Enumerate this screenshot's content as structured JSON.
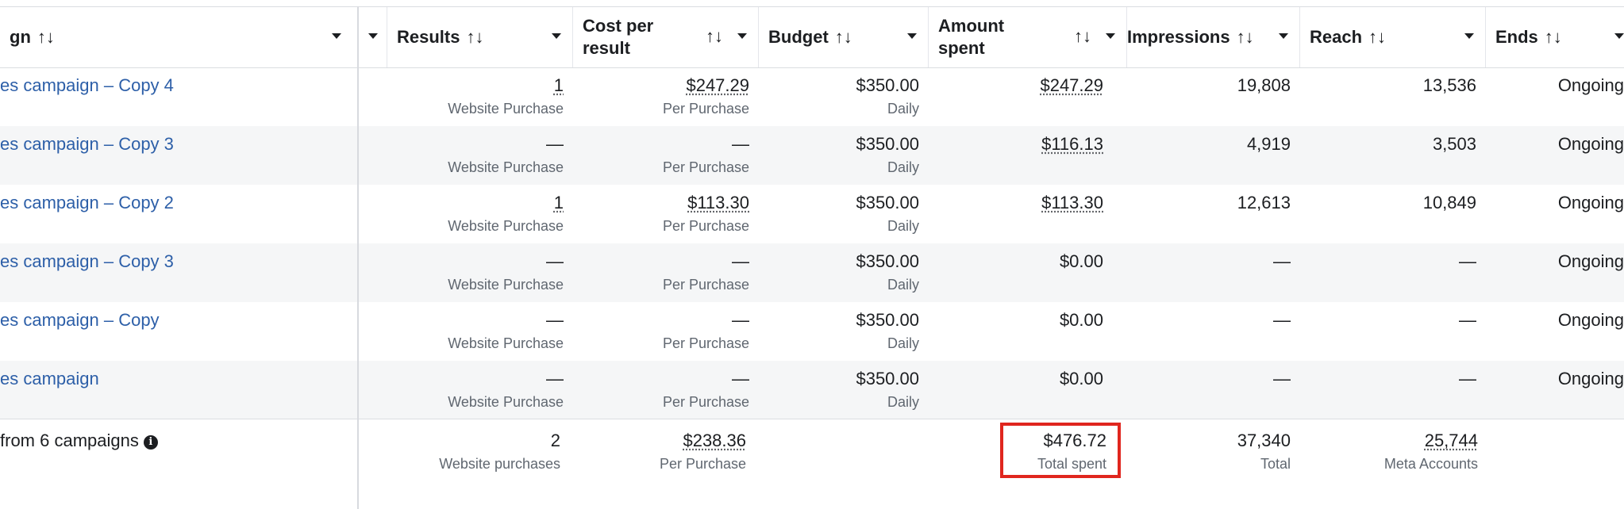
{
  "header": {
    "campaign": "gn",
    "results": "Results",
    "cost_per_result_line1": "Cost per",
    "cost_per_result_line2": "result",
    "budget": "Budget",
    "amount_spent_line1": "Amount",
    "amount_spent_line2": "spent",
    "impressions": "Impressions",
    "reach": "Reach",
    "ends": "Ends",
    "sort_glyph": "↑↓"
  },
  "rows": [
    {
      "name": "es campaign – Copy 4",
      "results": "1",
      "results_sub": "Website Purchase",
      "cost": "$247.29",
      "cost_sub": "Per Purchase",
      "budget": "$350.00",
      "budget_sub": "Daily",
      "spent": "$247.29",
      "impressions": "19,808",
      "reach": "13,536",
      "ends": "Ongoing"
    },
    {
      "name": "es campaign – Copy 3",
      "results": "—",
      "results_sub": "Website Purchase",
      "cost": "—",
      "cost_sub": "Per Purchase",
      "budget": "$350.00",
      "budget_sub": "Daily",
      "spent": "$116.13",
      "impressions": "4,919",
      "reach": "3,503",
      "ends": "Ongoing"
    },
    {
      "name": "es campaign – Copy 2",
      "results": "1",
      "results_sub": "Website Purchase",
      "cost": "$113.30",
      "cost_sub": "Per Purchase",
      "budget": "$350.00",
      "budget_sub": "Daily",
      "spent": "$113.30",
      "impressions": "12,613",
      "reach": "10,849",
      "ends": "Ongoing"
    },
    {
      "name": "es campaign – Copy 3",
      "results": "—",
      "results_sub": "Website Purchase",
      "cost": "—",
      "cost_sub": "Per Purchase",
      "budget": "$350.00",
      "budget_sub": "Daily",
      "spent": "$0.00",
      "impressions": "—",
      "reach": "—",
      "ends": "Ongoing"
    },
    {
      "name": "es campaign – Copy",
      "results": "—",
      "results_sub": "Website Purchase",
      "cost": "—",
      "cost_sub": "Per Purchase",
      "budget": "$350.00",
      "budget_sub": "Daily",
      "spent": "$0.00",
      "impressions": "—",
      "reach": "—",
      "ends": "Ongoing"
    },
    {
      "name": "es campaign",
      "results": "—",
      "results_sub": "Website Purchase",
      "cost": "—",
      "cost_sub": "Per Purchase",
      "budget": "$350.00",
      "budget_sub": "Daily",
      "spent": "$0.00",
      "impressions": "—",
      "reach": "—",
      "ends": "Ongoing"
    }
  ],
  "totals": {
    "label": "from 6 campaigns",
    "info_icon": "i",
    "results": "2",
    "results_sub": "Website purchases",
    "cost": "$238.36",
    "cost_sub": "Per Purchase",
    "spent": "$476.72",
    "spent_sub": "Total spent",
    "impressions": "37,340",
    "impressions_sub": "Total",
    "reach": "25,744",
    "reach_sub": "Meta Accounts"
  },
  "colors": {
    "link": "#2d5fa8",
    "highlight": "#e0261e",
    "row_alt": "#f5f6f7"
  }
}
